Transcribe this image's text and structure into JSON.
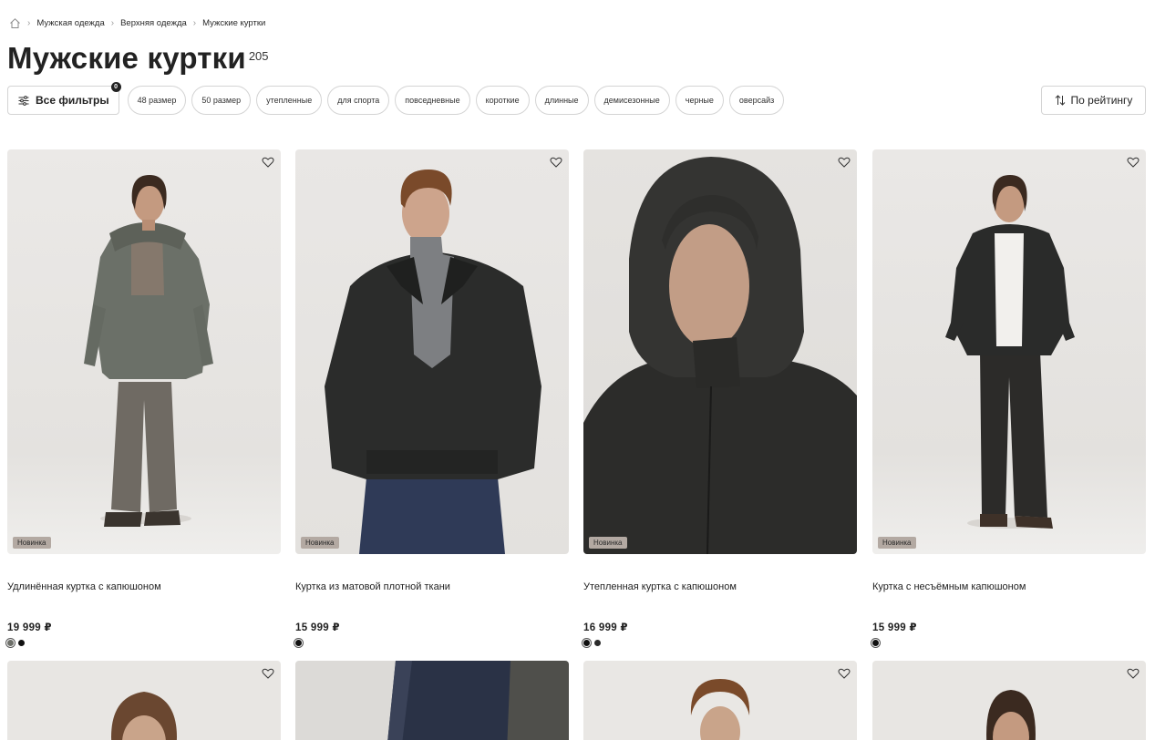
{
  "breadcrumb": [
    "Мужская одежда",
    "Верхняя одежда",
    "Мужские куртки"
  ],
  "title": "Мужские куртки",
  "count": "205",
  "filters": {
    "all_label": "Все фильтры",
    "badge": "0",
    "chips": [
      "48 размер",
      "50 размер",
      "утепленные",
      "для спорта",
      "повседневные",
      "короткие",
      "длинные",
      "демисезонные",
      "черные",
      "оверсайз"
    ]
  },
  "sort_label": "По рейтингу",
  "products": [
    {
      "name": "Удлинённая куртка с капюшоном",
      "price": "19 999 ₽",
      "tag": "Новинка",
      "swatches": [
        "#6d6f69",
        "#111111"
      ]
    },
    {
      "name": "Куртка из матовой плотной ткани",
      "price": "15 999 ₽",
      "tag": "Новинка",
      "swatches": [
        "#111111"
      ]
    },
    {
      "name": "Утепленная куртка с капюшоном",
      "price": "16 999 ₽",
      "tag": "Новинка",
      "swatches": [
        "#111111",
        "#2a2a2a"
      ]
    },
    {
      "name": "Куртка с несъёмным капюшоном",
      "price": "15 999 ₽",
      "tag": "Новинка",
      "swatches": [
        "#111111"
      ]
    }
  ],
  "colors": {
    "text": "#222222",
    "border": "#d4d4d4",
    "tag_bg": "#b3a9a2"
  },
  "icons": {
    "home": "home-icon",
    "favorite": "heart-icon",
    "filter": "sliders-icon",
    "sort": "sort-arrows-icon"
  }
}
